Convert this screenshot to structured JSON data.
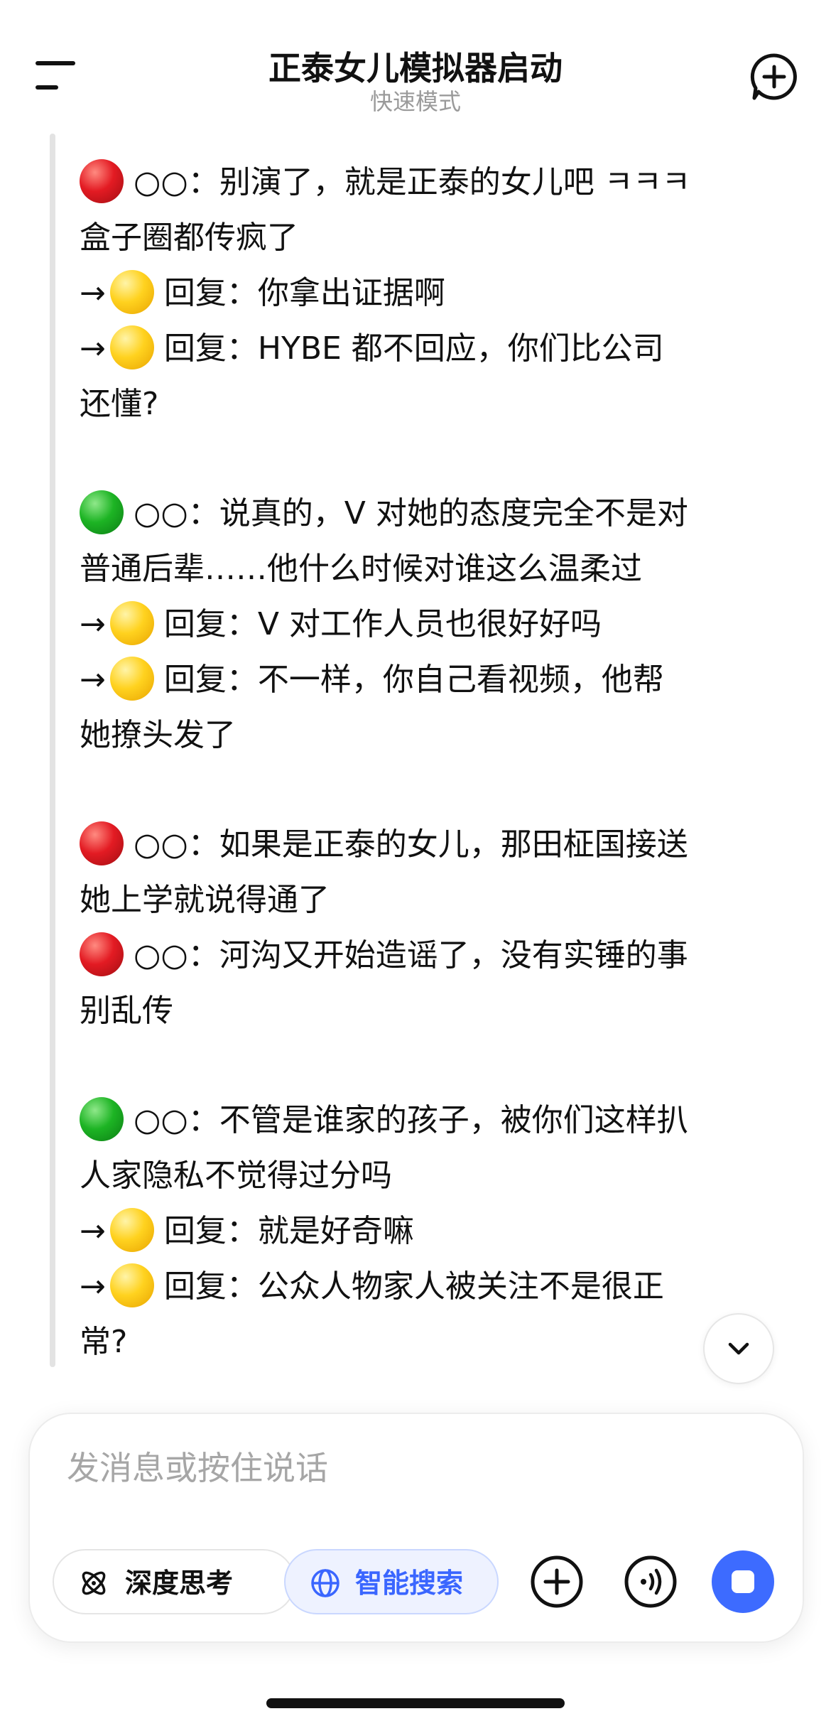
{
  "header": {
    "title": "正泰女儿模拟器启动",
    "subtitle": "快速模式",
    "menu_icon": "menu-icon",
    "new_chat_icon": "new-chat-icon"
  },
  "message": {
    "lines": [
      {
        "emoji": "red",
        "text": "○○：别演了，就是正泰的女儿吧 ㅋㅋㅋ"
      },
      {
        "text": "盒子圈都传疯了"
      },
      {
        "reply": true,
        "emoji": "yellow",
        "text": "回复：你拿出证据啊"
      },
      {
        "reply": true,
        "emoji": "yellow",
        "text": "回复：HYBE 都不回应，你们比公司"
      },
      {
        "text": "还懂?"
      },
      {
        "gap": true
      },
      {
        "emoji": "green",
        "text": "○○：说真的，V 对她的态度完全不是对"
      },
      {
        "text": "普通后辈……他什么时候对谁这么温柔过"
      },
      {
        "reply": true,
        "emoji": "yellow",
        "text": "回复：V 对工作人员也很好好吗"
      },
      {
        "reply": true,
        "emoji": "yellow",
        "text": "回复：不一样，你自己看视频，他帮"
      },
      {
        "text": "她撩头发了"
      },
      {
        "gap": true
      },
      {
        "emoji": "red",
        "text": "○○：如果是正泰的女儿，那田柾国接送"
      },
      {
        "text": "她上学就说得通了"
      },
      {
        "emoji": "red",
        "text": "○○：河沟又开始造谣了，没有实锤的事"
      },
      {
        "text": "别乱传"
      },
      {
        "gap": true
      },
      {
        "emoji": "green",
        "text": "○○：不管是谁家的孩子，被你们这样扒"
      },
      {
        "text": "人家隐私不觉得过分吗"
      },
      {
        "reply": true,
        "emoji": "yellow",
        "text": "回复：就是好奇嘛"
      },
      {
        "reply": true,
        "emoji": "yellow",
        "text": "回复：公众人物家人被关注不是很正"
      },
      {
        "text": "常?"
      }
    ],
    "reply_arrow": "→"
  },
  "input": {
    "placeholder": "发消息或按住说话",
    "deep_think_label": "深度思考",
    "smart_search_label": "智能搜索",
    "active_color": "#3d6bff"
  }
}
